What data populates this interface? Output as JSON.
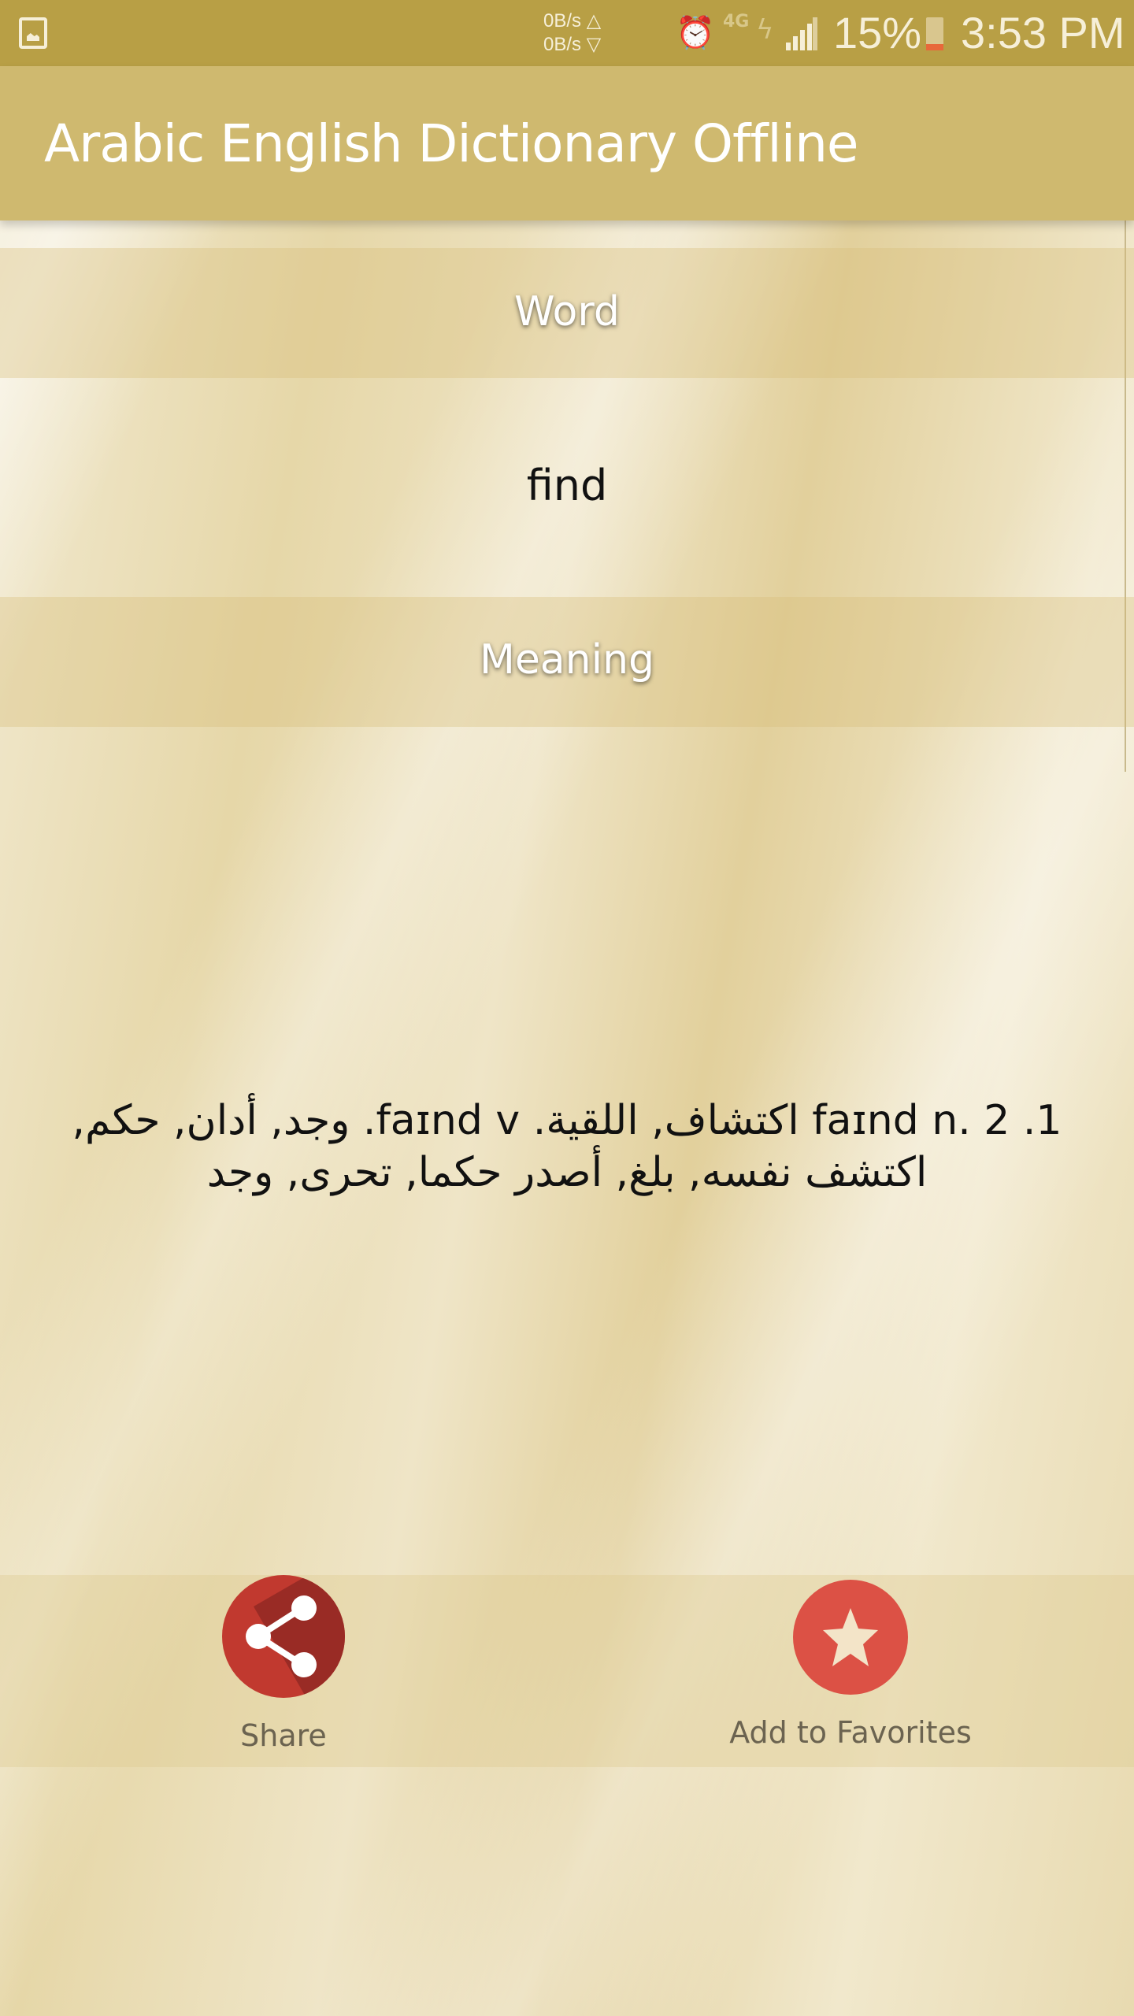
{
  "status_bar": {
    "notification_icon": "image-icon",
    "upload_speed": "0B/s △",
    "download_speed": "0B/s ▽",
    "alarm_icon": "alarm-icon",
    "network_type": "4G",
    "signal_icon": "signal-icon",
    "battery_percent": "15%",
    "time": "3:53 PM"
  },
  "app_bar": {
    "title": "Arabic English Dictionary Offline"
  },
  "word_section": {
    "label": "Word",
    "value": "find"
  },
  "meaning_section": {
    "label": "Meaning",
    "text": "1. faɪnd n. 2 اكتشاف, اللقية. faɪnd v. وجد, أدان, حكم, اكتشف نفسه, بلغ, أصدر حكما, تحرى, وجد"
  },
  "actions": {
    "share": {
      "label": "Share",
      "icon": "share-icon",
      "color": "#c1392f"
    },
    "favorites": {
      "label": "Add to Favorites",
      "icon": "star-icon",
      "color": "#dc5145"
    }
  },
  "colors": {
    "status_bar": "#b89f45",
    "app_bar": "#cfb96f"
  }
}
